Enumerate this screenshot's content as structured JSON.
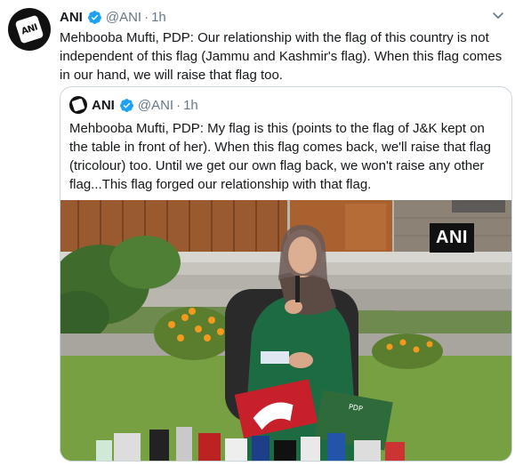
{
  "tweet": {
    "avatar_icon": "ani-logo",
    "name": "ANI",
    "handle": "@ANI",
    "separator": "·",
    "time": "1h",
    "text": "Mehbooba Mufti, PDP: Our relationship with the flag of this country is not independent of this flag (Jammu and Kashmir's flag). When this flag comes in our hand, we will raise that flag too."
  },
  "quoted_tweet": {
    "avatar_icon": "ani-logo",
    "name": "ANI",
    "handle": "@ANI",
    "separator": "·",
    "time": "1h",
    "text": "Mehbooba Mufti, PDP: My flag is this (points to the flag of J&K kept on the table in front of her). When this flag comes back, we'll raise that flag (tricolour) too. Until we get our own flag back, we won't raise any other flag...This flag forged our relationship with that flag.",
    "media": {
      "watermark": "ANI",
      "flag_label": "PDP"
    }
  },
  "colors": {
    "verified": "#1da1f2",
    "muted": "#657786",
    "text": "#14171a",
    "border": "#ccd6dd"
  }
}
